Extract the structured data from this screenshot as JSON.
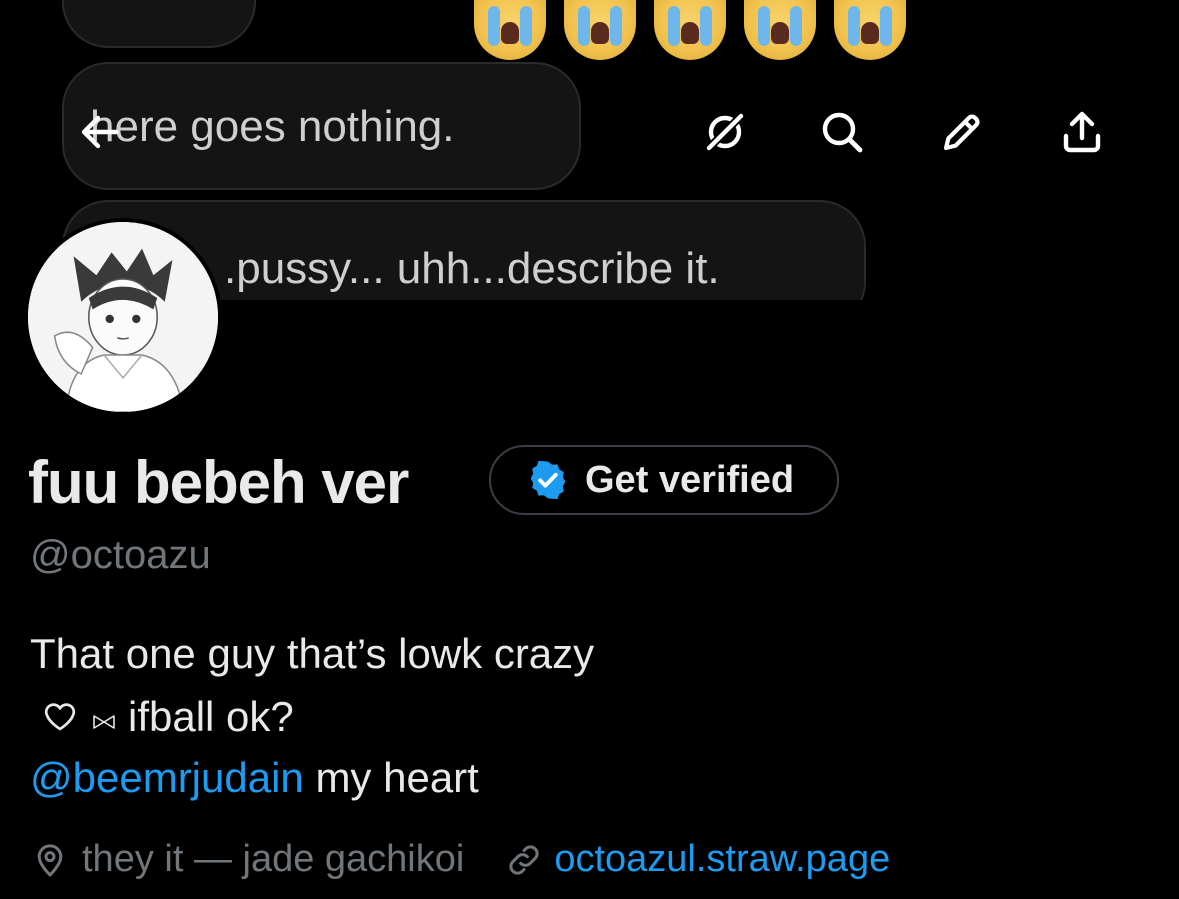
{
  "banner": {
    "bubbles": [
      "here goes nothing.",
      ".pussy... uhh...describe it."
    ],
    "emoji_count": 5,
    "emoji_name": "loudly-crying-face"
  },
  "nav": {
    "icons": [
      "back-arrow-icon",
      "grok-icon",
      "search-icon",
      "edit-icon",
      "share-icon"
    ]
  },
  "profile": {
    "display_name": "fuu bebeh ver",
    "verify_label": "Get verified",
    "handle": "@octoazu",
    "bio": {
      "line1": "That one guy that’s lowk crazy",
      "line2_text": "ifball ok?",
      "mention": "@beemrjudain",
      "line3_rest": " my heart"
    },
    "location": "they it — jade gachikoi",
    "website": "octoazul.straw.page"
  },
  "colors": {
    "background": "#000000",
    "text": "#e7e9ea",
    "secondary": "#71767b",
    "accent": "#1d9bf0"
  }
}
